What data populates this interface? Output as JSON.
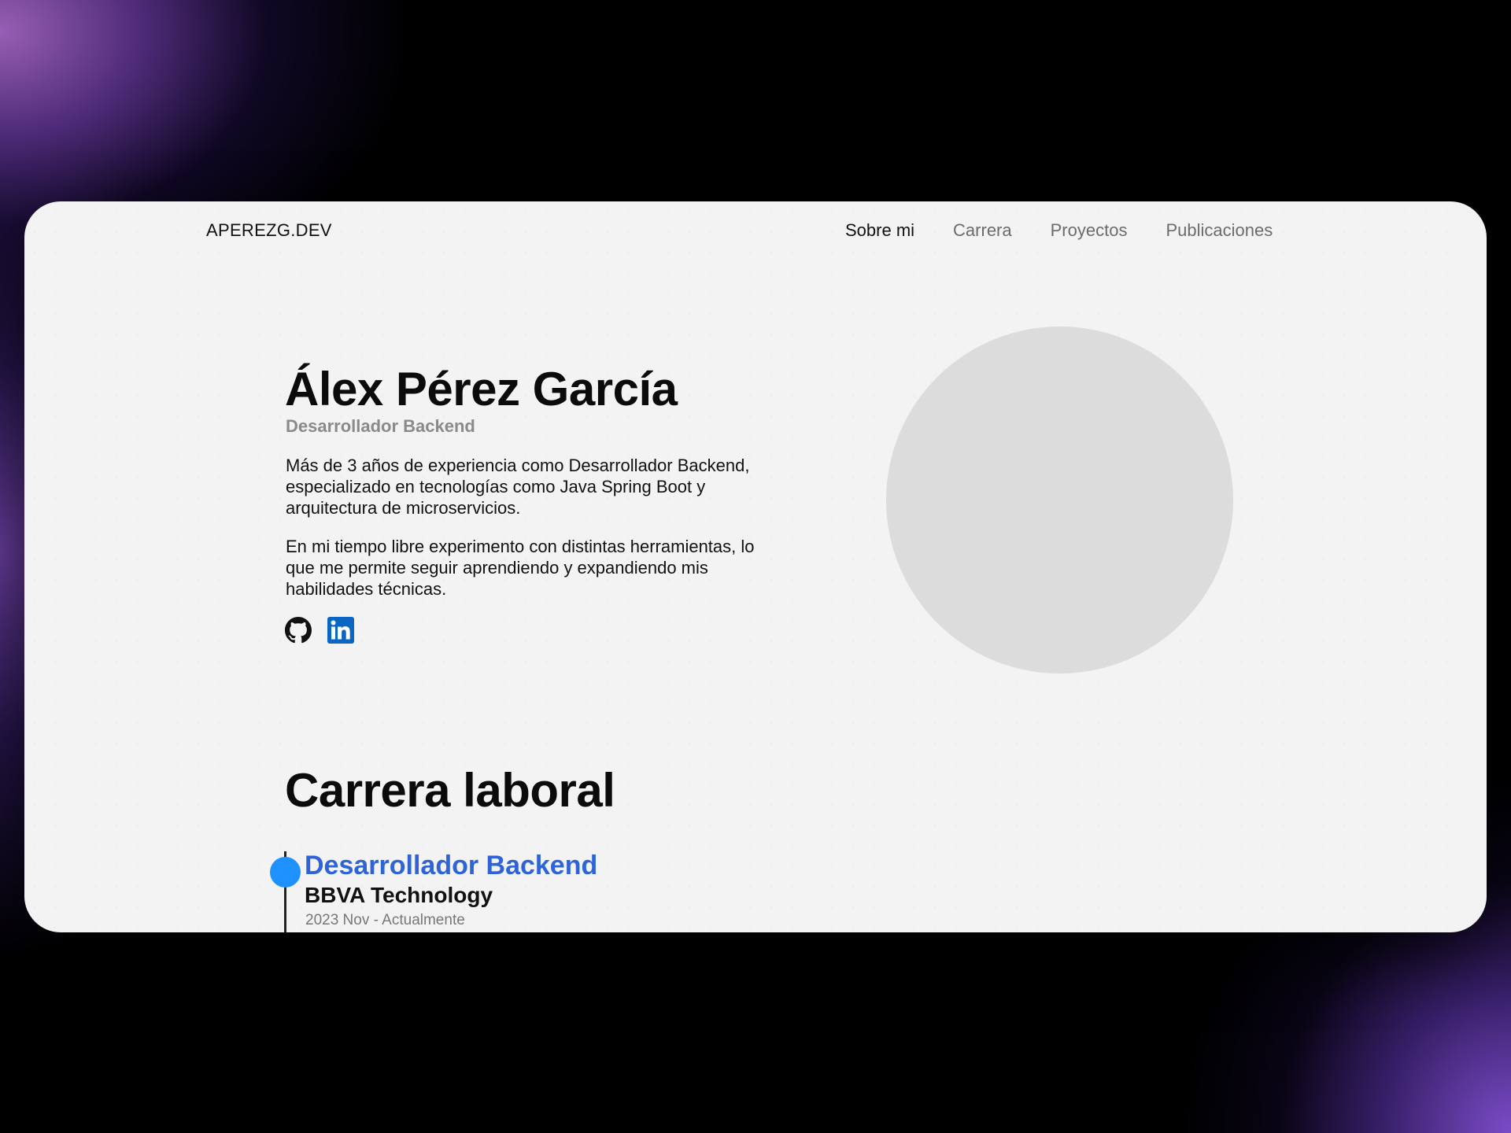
{
  "nav": {
    "brand": "APEREZG.DEV",
    "links": [
      {
        "label": "Sobre mi",
        "active": true
      },
      {
        "label": "Carrera",
        "active": false
      },
      {
        "label": "Proyectos",
        "active": false
      },
      {
        "label": "Publicaciones",
        "active": false
      }
    ]
  },
  "hero": {
    "name": "Álex Pérez García",
    "role": "Desarrollador Backend",
    "bio": [
      "Más de 3 años de experiencia como Desarrollador Backend, especializado en tecnologías como Java Spring Boot y arquitectura de microservicios.",
      "En mi tiempo libre experimento con distintas herramientas, lo que me permite seguir aprendiendo y expandiendo mis habilidades técnicas."
    ],
    "socials": [
      {
        "icon": "github-icon",
        "color": "#111111"
      },
      {
        "icon": "linkedin-icon",
        "color": "#0a66c2"
      }
    ]
  },
  "career": {
    "title": "Carrera laboral",
    "jobs": [
      {
        "title": "Desarrollador Backend",
        "company": "BBVA Technology",
        "dates": "2023 Nov - Actualmente"
      }
    ]
  },
  "colors": {
    "accent_blue": "#2f63d8",
    "timeline_dot": "#1e90ff",
    "page_bg": "#f3f3f3",
    "avatar_placeholder": "#dcdcdc"
  }
}
